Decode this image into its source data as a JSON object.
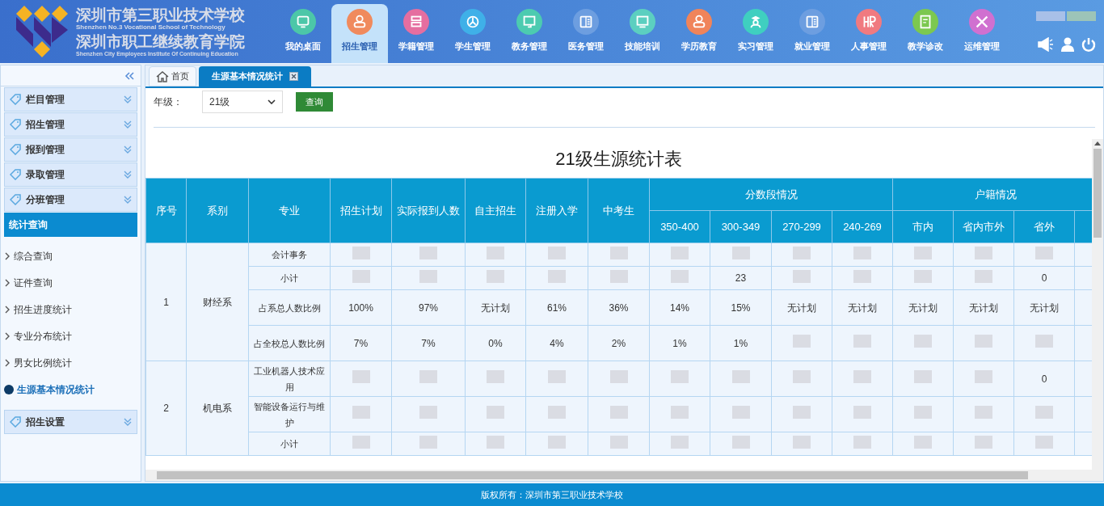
{
  "header": {
    "school_name_cn": "深圳市第三职业技术学校",
    "school_name_en": "Shenzhen No.3 Vocational School of Technology",
    "institute_name_cn": "深圳市职工继续教育学院",
    "institute_name_en": "Shenzhen City Employees Institute Of Continuing Education",
    "nav": [
      {
        "label": "我的桌面",
        "color": "#4cc7a8",
        "selected": false
      },
      {
        "label": "招生管理",
        "color": "#f08a5d",
        "selected": true
      },
      {
        "label": "学籍管理",
        "color": "#e56ea0",
        "selected": false
      },
      {
        "label": "学生管理",
        "color": "#3fb0e8",
        "selected": false
      },
      {
        "label": "教务管理",
        "color": "#4ccbb0",
        "selected": false
      },
      {
        "label": "医务管理",
        "color": "#6d9ee0",
        "selected": false
      },
      {
        "label": "技能培训",
        "color": "#5ccfc0",
        "selected": false
      },
      {
        "label": "学历教育",
        "color": "#f0845a",
        "selected": false
      },
      {
        "label": "实习管理",
        "color": "#3fcfc0",
        "selected": false
      },
      {
        "label": "就业管理",
        "color": "#6d9ee0",
        "selected": false
      },
      {
        "label": "人事管理",
        "color": "#f07a80",
        "selected": false
      },
      {
        "label": "教学诊改",
        "color": "#7cc850",
        "selected": false
      },
      {
        "label": "运维管理",
        "color": "#d070d0",
        "selected": false
      }
    ]
  },
  "sidebar": {
    "groups": [
      {
        "label": "栏目管理",
        "expanded": false
      },
      {
        "label": "招生管理",
        "expanded": false
      },
      {
        "label": "报到管理",
        "expanded": false
      },
      {
        "label": "录取管理",
        "expanded": false
      },
      {
        "label": "分班管理",
        "expanded": false
      },
      {
        "label": "统计查询",
        "expanded": true,
        "children": [
          {
            "label": "综合查询",
            "selected": false
          },
          {
            "label": "证件查询",
            "selected": false
          },
          {
            "label": "招生进度统计",
            "selected": false
          },
          {
            "label": "专业分布统计",
            "selected": false
          },
          {
            "label": "男女比例统计",
            "selected": false
          },
          {
            "label": "生源基本情况统计",
            "selected": true
          }
        ]
      },
      {
        "label": "招生设置",
        "expanded": false
      }
    ]
  },
  "tabs": [
    {
      "label": "首页",
      "selected": false,
      "closable": false
    },
    {
      "label": "生源基本情况统计",
      "selected": true,
      "closable": true
    }
  ],
  "filter": {
    "label": "年级：",
    "grade": "21级",
    "button": "查询"
  },
  "table": {
    "title": "21级生源统计表",
    "columns": [
      {
        "label": "序号"
      },
      {
        "label": "系别"
      },
      {
        "label": "专业"
      },
      {
        "label": "招生计划"
      },
      {
        "label": "实际报到人数"
      },
      {
        "label": "自主招生"
      },
      {
        "label": "注册入学"
      },
      {
        "label": "中考生"
      },
      {
        "label": "分数段情况",
        "children": [
          {
            "label": "350-400"
          },
          {
            "label": "300-349"
          },
          {
            "label": "270-299"
          },
          {
            "label": "240-269"
          }
        ]
      },
      {
        "label": "户籍情况",
        "children": [
          {
            "label": "市内"
          },
          {
            "label": "省内市外"
          },
          {
            "label": "省外"
          }
        ]
      }
    ],
    "departments": [
      {
        "index": "1",
        "name": "财经系",
        "rows": [
          {
            "major": "会计事务",
            "cells": [
              {
                "kind": "blurred"
              },
              {
                "kind": "blurred"
              },
              {
                "kind": "blurred"
              },
              {
                "kind": "blurred"
              },
              {
                "kind": "blurred"
              },
              {
                "kind": "blurred"
              },
              {
                "kind": "blurred"
              },
              {
                "kind": "blurred"
              },
              {
                "kind": "blurred"
              },
              {
                "kind": "blurred"
              },
              {
                "kind": "blurred"
              },
              {
                "kind": "blurred"
              }
            ]
          },
          {
            "major": "小计",
            "cells": [
              {
                "kind": "blurred"
              },
              {
                "kind": "blurred"
              },
              {
                "kind": "blurred"
              },
              {
                "kind": "blurred"
              },
              {
                "kind": "blurred"
              },
              {
                "kind": "blurred"
              },
              "23",
              {
                "kind": "blurred"
              },
              {
                "kind": "blurred"
              },
              {
                "kind": "blurred"
              },
              {
                "kind": "blurred"
              },
              "0"
            ]
          },
          {
            "major": "占系总人数比例",
            "cells": [
              "100%",
              "97%",
              "无计划",
              "61%",
              "36%",
              "14%",
              "15%",
              "无计划",
              "无计划",
              "无计划",
              "无计划",
              "无计划"
            ]
          },
          {
            "major": "占全校总人数比例",
            "cells": [
              "7%",
              "7%",
              "0%",
              "4%",
              "2%",
              "1%",
              "1%",
              {
                "kind": "blurred"
              },
              {
                "kind": "blurred"
              },
              {
                "kind": "blurred"
              },
              {
                "kind": "blurred"
              },
              {
                "kind": "blurred"
              }
            ]
          }
        ]
      },
      {
        "index": "2",
        "name": "机电系",
        "rows": [
          {
            "major": "工业机器人技术应用",
            "cells": [
              {
                "kind": "blurred"
              },
              {
                "kind": "blurred"
              },
              {
                "kind": "blurred"
              },
              {
                "kind": "blurred"
              },
              {
                "kind": "blurred"
              },
              {
                "kind": "blurred"
              },
              {
                "kind": "blurred"
              },
              {
                "kind": "blurred"
              },
              {
                "kind": "blurred"
              },
              {
                "kind": "blurred"
              },
              {
                "kind": "blurred"
              },
              "0"
            ]
          },
          {
            "major": "智能设备运行与维护",
            "cells": [
              {
                "kind": "blurred"
              },
              {
                "kind": "blurred"
              },
              {
                "kind": "blurred"
              },
              {
                "kind": "blurred"
              },
              {
                "kind": "blurred"
              },
              {
                "kind": "blurred"
              },
              {
                "kind": "blurred"
              },
              {
                "kind": "blurred"
              },
              {
                "kind": "blurred"
              },
              {
                "kind": "blurred"
              },
              {
                "kind": "blurred"
              },
              {
                "kind": "blurred"
              }
            ]
          },
          {
            "major": "小计",
            "cells": [
              {
                "kind": "blurred"
              },
              {
                "kind": "blurred"
              },
              {
                "kind": "blurred"
              },
              {
                "kind": "blurred"
              },
              {
                "kind": "blurred"
              },
              {
                "kind": "blurred"
              },
              {
                "kind": "blurred"
              },
              {
                "kind": "blurred"
              },
              {
                "kind": "blurred"
              },
              {
                "kind": "blurred"
              },
              {
                "kind": "blurred"
              },
              {
                "kind": "blurred"
              }
            ]
          }
        ]
      }
    ]
  },
  "footer": "版权所有：深圳市第三职业技术学校"
}
